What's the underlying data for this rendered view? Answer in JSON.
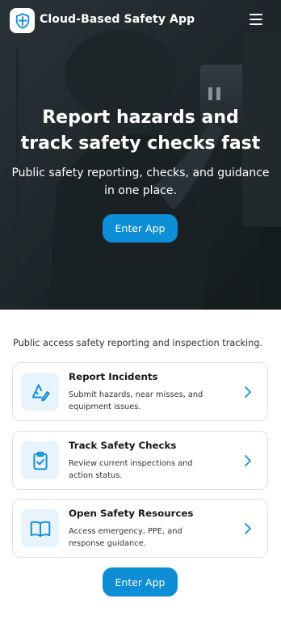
{
  "app": {
    "title": "Cloud-Based Safety App",
    "logo_icon": "shield-icon",
    "menu_icon": "hamburger-menu-icon"
  },
  "hero": {
    "title_line1": "Report hazards and",
    "title_line2": "track safety checks fast",
    "subtitle_line1": "Public safety reporting, checks, and guidance",
    "subtitle_line2": "in one place.",
    "cta_label": "Enter App"
  },
  "main": {
    "intro": "Public access safety reporting and inspection tracking.",
    "cards": [
      {
        "title": "Report Incidents",
        "desc_line1": "Submit hazards, near misses, and",
        "desc_line2": "equipment issues.",
        "icon": "hazard-pen-icon"
      },
      {
        "title": "Track Safety Checks",
        "desc_line1": "Review current inspections and",
        "desc_line2": "action status.",
        "icon": "clipboard-check-icon"
      },
      {
        "title": "Open Safety Resources",
        "desc_line1": "Access emergency, PPE, and",
        "desc_line2": "response guidance.",
        "icon": "book-icon"
      }
    ],
    "cta_label": "Enter App"
  },
  "colors": {
    "accent": "#0f8ed8",
    "hero_bg": "#1c2326",
    "card_icon_bg": "#e8f3fb",
    "card_border": "#dde1e6"
  }
}
